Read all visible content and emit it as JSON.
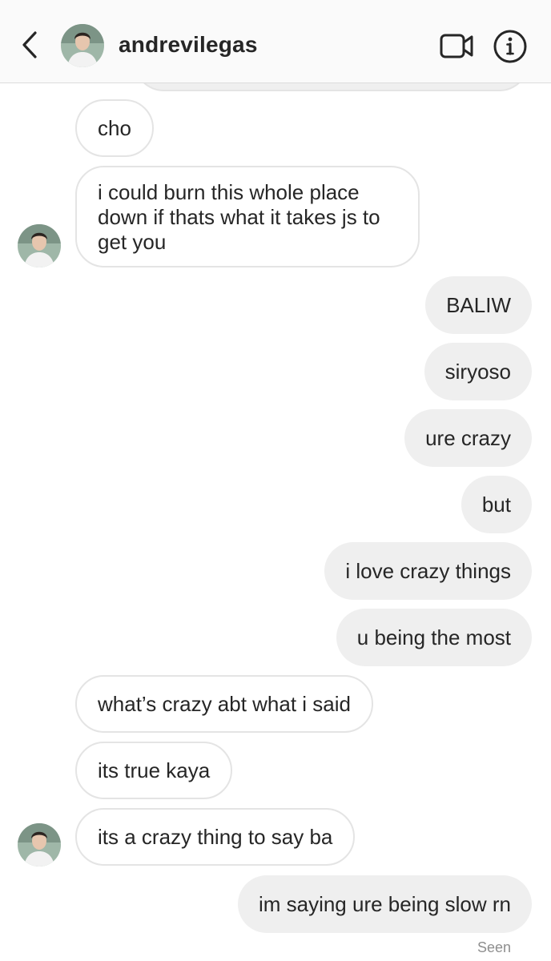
{
  "header": {
    "username": "andrevilegas",
    "icons": {
      "back": "chevron-left-icon",
      "video": "video-camera-icon",
      "info": "info-icon"
    }
  },
  "messages": [
    {
      "from": "them",
      "text": "cho"
    },
    {
      "from": "them",
      "text": "i could burn this whole place down if thats what it takes js to get you"
    },
    {
      "from": "me",
      "text": "BALIW"
    },
    {
      "from": "me",
      "text": "siryoso"
    },
    {
      "from": "me",
      "text": "ure crazy"
    },
    {
      "from": "me",
      "text": "but"
    },
    {
      "from": "me",
      "text": "i love crazy things"
    },
    {
      "from": "me",
      "text": "u being the most"
    },
    {
      "from": "them",
      "text": "what’s crazy abt what i said"
    },
    {
      "from": "them",
      "text": "its true kaya"
    },
    {
      "from": "them",
      "text": "its a crazy thing to say ba"
    },
    {
      "from": "me",
      "text": "im saying ure being slow rn"
    }
  ],
  "status": {
    "seen": "Seen"
  },
  "colors": {
    "incoming_border": "#e4e4e4",
    "outgoing_bg": "#efefef",
    "text": "#262626",
    "muted": "#8e8e8e"
  }
}
